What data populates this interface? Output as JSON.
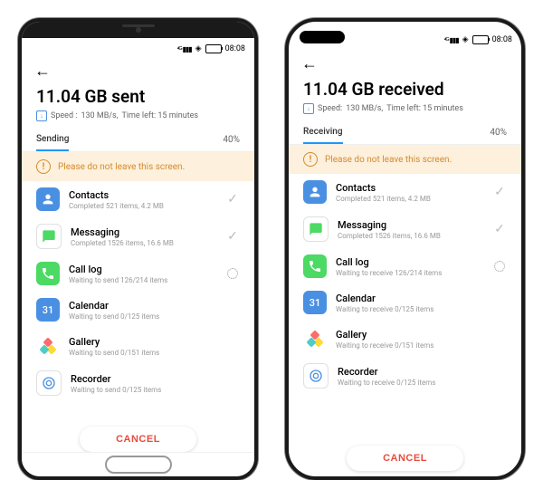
{
  "status_time": "08:08",
  "left": {
    "title": "11.04 GB sent",
    "speed_label": "Speed :",
    "speed_value": "130 MB/s,",
    "time_left": "Time left: 15 minutes",
    "tab": "Sending",
    "percent": "40%",
    "warn": "Please do not leave this screen.",
    "items": [
      {
        "icon": "contacts",
        "name": "Contacts",
        "sub": "Completed 521 items, 4.2 MB",
        "state": "done"
      },
      {
        "icon": "msg",
        "name": "Messaging",
        "sub": "Completed 1526 items, 16.6 MB",
        "state": "done"
      },
      {
        "icon": "call",
        "name": "Call log",
        "sub": "Waiting to send 126/214 items",
        "state": "busy"
      },
      {
        "icon": "cal",
        "name": "Calendar",
        "sub": "Waiting to send  0/125 items",
        "state": ""
      },
      {
        "icon": "gallery",
        "name": "Gallery",
        "sub": "Waiting to send  0/151 items",
        "state": ""
      },
      {
        "icon": "rec",
        "name": "Recorder",
        "sub": "Waiting to send  0/125 items",
        "state": ""
      }
    ],
    "cancel": "CANCEL",
    "cal_num": "31"
  },
  "right": {
    "title": "11.04 GB received",
    "speed_label": "Speed:",
    "speed_value": "130 MB/s,",
    "time_left": "Time left: 15 minutes",
    "tab": "Receiving",
    "percent": "40%",
    "warn": "Please do not leave this screen.",
    "items": [
      {
        "icon": "contacts",
        "name": "Contacts",
        "sub": "Completed 521 items, 4.2 MB",
        "state": "done"
      },
      {
        "icon": "msg",
        "name": "Messaging",
        "sub": "Completed 1526 items, 16.6 MB",
        "state": "done"
      },
      {
        "icon": "call",
        "name": "Call log",
        "sub": "Waiting to receive 126/214 items",
        "state": "busy"
      },
      {
        "icon": "cal",
        "name": "Calendar",
        "sub": "Waiting to receive  0/125 items",
        "state": ""
      },
      {
        "icon": "gallery",
        "name": "Gallery",
        "sub": "Waiting to receive  0/151 items",
        "state": ""
      },
      {
        "icon": "rec",
        "name": "Recorder",
        "sub": "Waiting to receive  0/125 items",
        "state": ""
      }
    ],
    "cancel": "CANCEL",
    "cal_num": "31"
  }
}
